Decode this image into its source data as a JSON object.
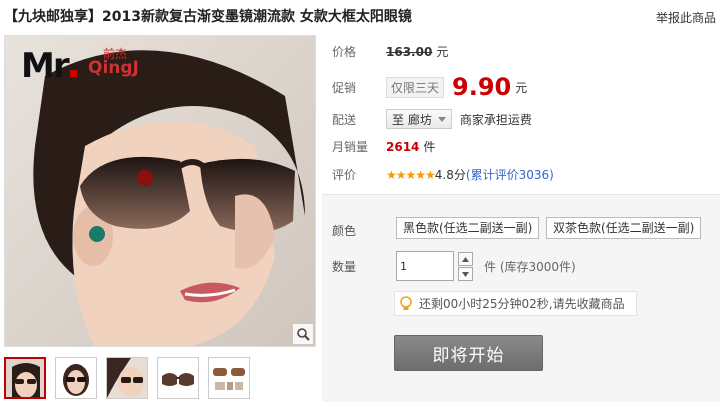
{
  "title": "【九块邮独享】2013新款复古渐变墨镜潮流款 女款大框太阳眼镜",
  "report_link": "举报此商品",
  "gallery": {
    "logo_main": "Mr",
    "logo_sub": "QingJ",
    "logo_cn": "前杰",
    "zoom_icon": "magnifier-icon",
    "thumbnail_count": 5
  },
  "info": {
    "price_label": "价格",
    "original_price": "163.00",
    "currency": "元",
    "promo_label": "促销",
    "promo_badge": "仅限三天",
    "promo_price": "9.90",
    "delivery_label": "配送",
    "delivery_dest": "至 廊坊",
    "shipping_note": "商家承担运费",
    "sales_label": "月销量",
    "sales_count": "2614",
    "sales_unit": "件",
    "rating_label": "评价",
    "stars": "★★★★★",
    "rating_score": "4.8分",
    "rating_total": "(累计评价3036)"
  },
  "purchase": {
    "color_label": "颜色",
    "color_options": [
      "黑色款(任选二副送一副)",
      "双茶色款(任选二副送一副)"
    ],
    "quantity_label": "数量",
    "quantity_value": "1",
    "stock_text": "件 (库存3000件)",
    "notice_text": "还剩00小时25分钟02秒,请先收藏商品",
    "cta_label": "即将开始"
  },
  "colors": {
    "price_red": "#cc0000",
    "star_orange": "#f59a00",
    "link_blue": "#3366cc",
    "cta_gray": "#7a7a7a"
  }
}
